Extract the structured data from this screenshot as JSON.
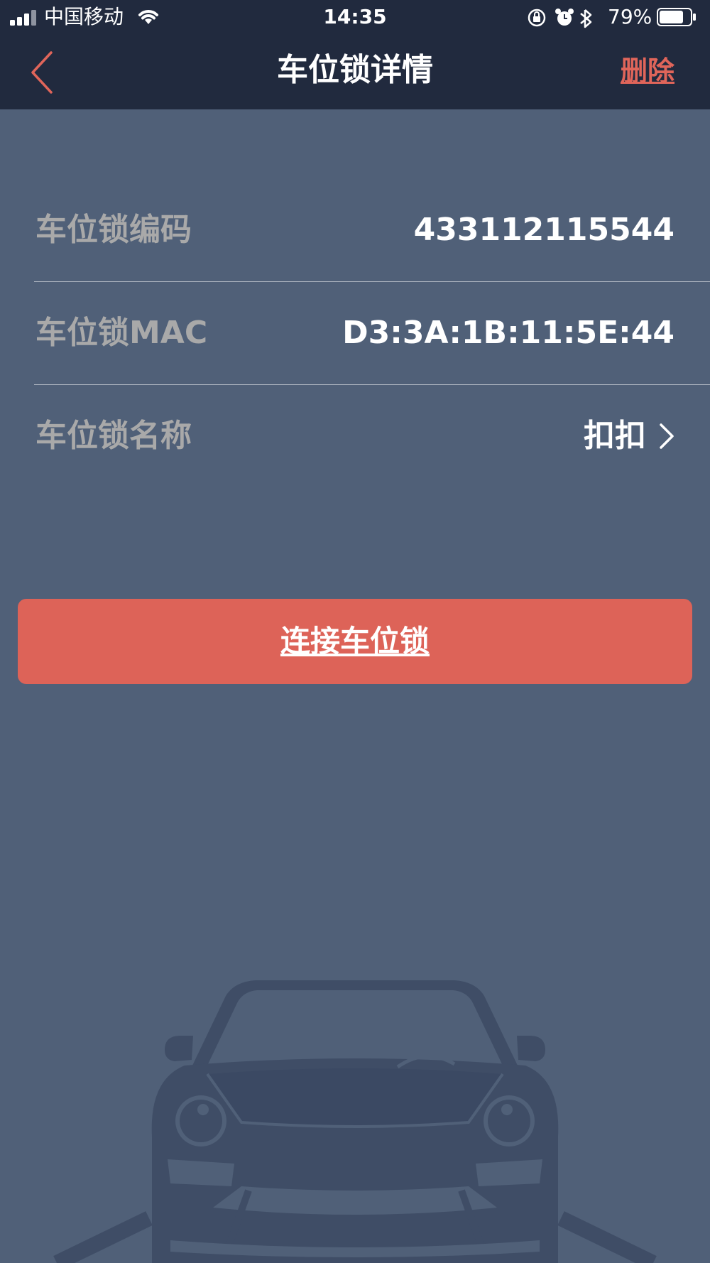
{
  "status_bar": {
    "carrier": "中国移动",
    "time": "14:35",
    "battery_percent": "79%",
    "battery_level": 0.79
  },
  "nav": {
    "title": "车位锁详情",
    "delete_label": "删除",
    "back_icon": "chevron-left-icon"
  },
  "details": {
    "rows": [
      {
        "label": "车位锁编码",
        "value": "433112115544"
      },
      {
        "label": "车位锁MAC",
        "value": "D3:3A:1B:11:5E:44"
      },
      {
        "label": "车位锁名称",
        "value": "扣扣"
      }
    ]
  },
  "connect_button": {
    "label": "连接车位锁"
  },
  "colors": {
    "bar_background": "#212a3e",
    "page_background": "#506078",
    "accent": "#dd6358",
    "label_gray": "#a9a9a9"
  }
}
